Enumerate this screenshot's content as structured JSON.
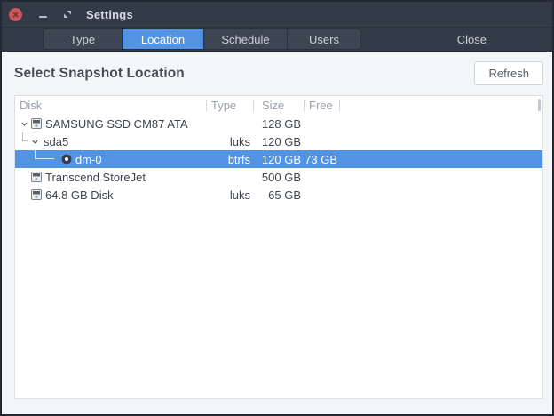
{
  "window": {
    "title": "Settings"
  },
  "titlebar_icons": [
    "close-icon",
    "minimize-icon",
    "restore-icon"
  ],
  "tabs": [
    {
      "label": "Type",
      "active": false
    },
    {
      "label": "Location",
      "active": true
    },
    {
      "label": "Schedule",
      "active": false
    },
    {
      "label": "Users",
      "active": false
    }
  ],
  "close_button": {
    "label": "Close"
  },
  "main": {
    "heading": "Select Snapshot Location",
    "refresh_label": "Refresh"
  },
  "table": {
    "columns": [
      "Disk",
      "Type",
      "Size",
      "Free"
    ],
    "rows": [
      {
        "name": "SAMSUNG SSD CM87 ATA",
        "type": "",
        "size": "128 GB",
        "free": "",
        "level": 0,
        "icon": "disk",
        "expanded": true,
        "selected": false
      },
      {
        "name": "sda5",
        "type": "luks",
        "size": "120 GB",
        "free": "",
        "level": 1,
        "icon": "none",
        "expanded": true,
        "selected": false
      },
      {
        "name": "dm-0",
        "type": "btrfs",
        "size": "120 GB",
        "free": "73 GB",
        "level": 2,
        "icon": "volume",
        "expanded": false,
        "selected": true
      },
      {
        "name": "Transcend StoreJet",
        "type": "",
        "size": "500 GB",
        "free": "",
        "level": 0,
        "icon": "disk",
        "expanded": false,
        "selected": false
      },
      {
        "name": "64.8 GB Disk",
        "type": "luks",
        "size": "65 GB",
        "free": "",
        "level": 0,
        "icon": "disk",
        "expanded": false,
        "selected": false
      }
    ]
  },
  "colors": {
    "accent": "#5294e2",
    "selection": "#5294e2",
    "titlebar_bg": "#343b48",
    "close_button_red": "#cc575d",
    "content_bg": "#f4f5f6",
    "table_bg": "#ffffff"
  }
}
